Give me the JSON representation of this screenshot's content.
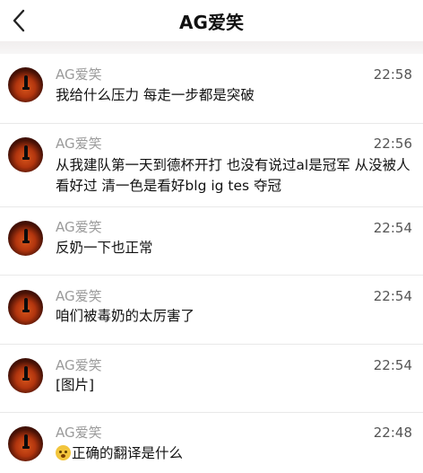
{
  "header": {
    "title": "AG爱笑",
    "back_icon": "chevron-left-icon"
  },
  "messages": [
    {
      "sender": "AG爱笑",
      "time": "22:58",
      "text": "我给什么压力 每走一步都是突破"
    },
    {
      "sender": "AG爱笑",
      "time": "22:56",
      "text": "从我建队第一天到德杯开打 也没有说过al是冠军 从没被人看好过 清一色是看好blg ig tes 夺冠"
    },
    {
      "sender": "AG爱笑",
      "time": "22:54",
      "text": "反奶一下也正常"
    },
    {
      "sender": "AG爱笑",
      "time": "22:54",
      "text": "咱们被毒奶的太厉害了"
    },
    {
      "sender": "AG爱笑",
      "time": "22:54",
      "text": "[图片]"
    },
    {
      "sender": "AG爱笑",
      "time": "22:48",
      "text": "正确的翻译是什么",
      "emoji": "thinking-face-icon"
    }
  ]
}
